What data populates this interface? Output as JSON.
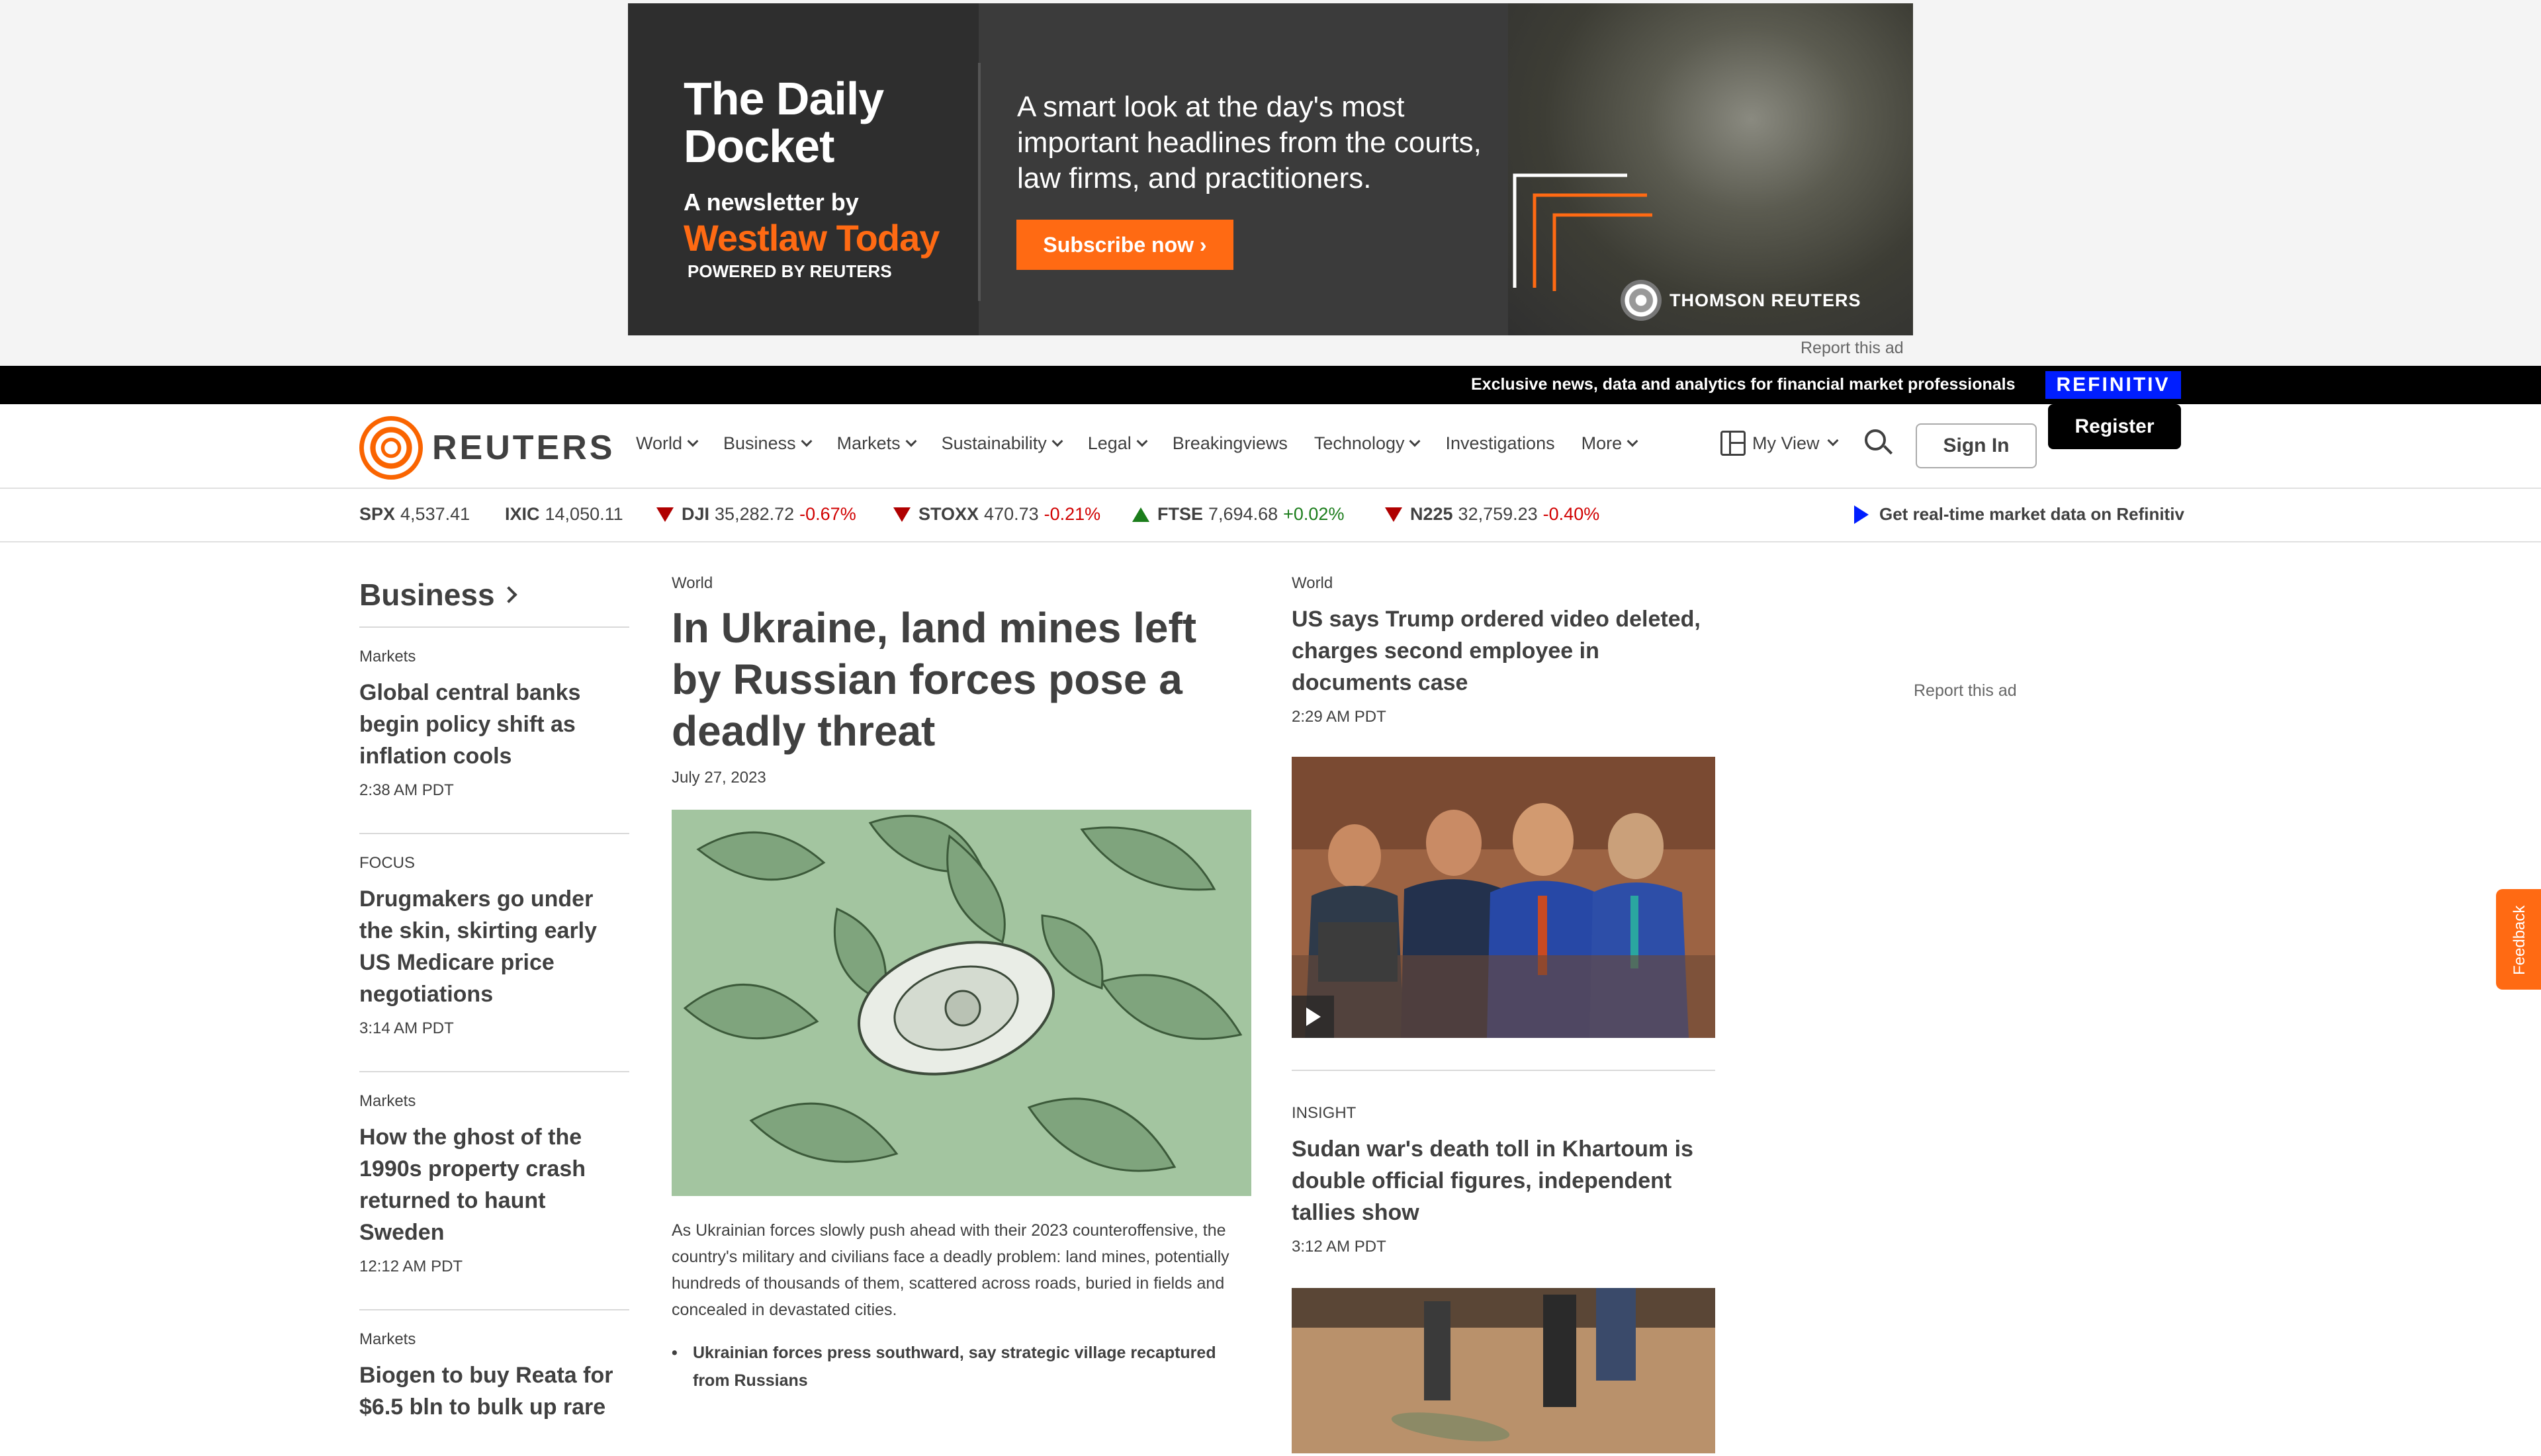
{
  "ad": {
    "title": "The Daily Docket",
    "subtitle": "A newsletter by",
    "brand": "Westlaw Today",
    "powered": "POWERED BY REUTERS",
    "copy": "A smart look at the day's most important headlines from the courts, law firms, and practitioners.",
    "cta": "Subscribe now ›",
    "sponsor": "THOMSON REUTERS",
    "report_label": "Report this ad",
    "accent_color": "#ff6a13"
  },
  "promo": {
    "text": "Exclusive news, data and analytics for financial market professionals",
    "badge": "REFINITIV",
    "badge_color": "#001eff"
  },
  "header": {
    "logo_text": "REUTERS",
    "logo_icon": "reuters-dot-logo-icon",
    "nav": [
      {
        "label": "World",
        "has_menu": true
      },
      {
        "label": "Business",
        "has_menu": true
      },
      {
        "label": "Markets",
        "has_menu": true
      },
      {
        "label": "Sustainability",
        "has_menu": true
      },
      {
        "label": "Legal",
        "has_menu": true
      },
      {
        "label": "Breakingviews",
        "has_menu": false
      },
      {
        "label": "Technology",
        "has_menu": true
      },
      {
        "label": "Investigations",
        "has_menu": false
      },
      {
        "label": "More",
        "has_menu": true
      }
    ],
    "my_view": "My View",
    "sign_in": "Sign In",
    "register": "Register"
  },
  "ticker": {
    "items": [
      {
        "symbol": "SPX",
        "value": "4,537.41",
        "change": "",
        "direction": "none"
      },
      {
        "symbol": "IXIC",
        "value": "14,050.11",
        "change": "",
        "direction": "none"
      },
      {
        "symbol": "DJI",
        "value": "35,282.72",
        "change": "-0.67%",
        "direction": "down"
      },
      {
        "symbol": "STOXX",
        "value": "470.73",
        "change": "-0.21%",
        "direction": "down"
      },
      {
        "symbol": "FTSE",
        "value": "7,694.68",
        "change": "+0.02%",
        "direction": "up"
      },
      {
        "symbol": "N225",
        "value": "32,759.23",
        "change": "-0.40%",
        "direction": "down"
      }
    ],
    "realtime_link": "Get real-time market data on Refinitiv"
  },
  "left": {
    "section_title": "Business",
    "stories": [
      {
        "kicker": "Markets",
        "headline": "Global central banks begin policy shift as inflation cools",
        "time": "2:38 AM PDT"
      },
      {
        "kicker": "FOCUS",
        "headline": "Drugmakers go under the skin, skirting early US Medicare price negotiations",
        "time": "3:14 AM PDT"
      },
      {
        "kicker": "Markets",
        "headline": "How the ghost of the 1990s property crash returned to haunt Sweden",
        "time": "12:12 AM PDT"
      },
      {
        "kicker": "Markets",
        "headline": "Biogen to buy Reata for $6.5 bln to bulk up rare",
        "time": ""
      }
    ]
  },
  "center": {
    "kicker": "World",
    "headline": "In Ukraine, land mines left by Russian forces pose a deadly threat",
    "date": "July 27, 2023",
    "summary": "As Ukrainian forces slowly push ahead with their 2023 counteroffensive, the country's military and civilians face a deadly problem: land mines, potentially hundreds of thousands of them, scattered across roads, buried in fields and concealed in devastated cities.",
    "related": "Ukrainian forces press southward, say strategic village recaptured from Russians"
  },
  "right": {
    "story1": {
      "kicker": "World",
      "headline": "US says Trump ordered video deleted, charges second employee in documents case",
      "time": "2:29 AM PDT"
    },
    "story2": {
      "kicker": "INSIGHT",
      "headline": "Sudan war's death toll in Khartoum is double official figures, independent tallies show",
      "time": "3:12 AM PDT"
    }
  },
  "side_ad": {
    "report_label": "Report this ad"
  },
  "feedback": {
    "label": "Feedback"
  }
}
